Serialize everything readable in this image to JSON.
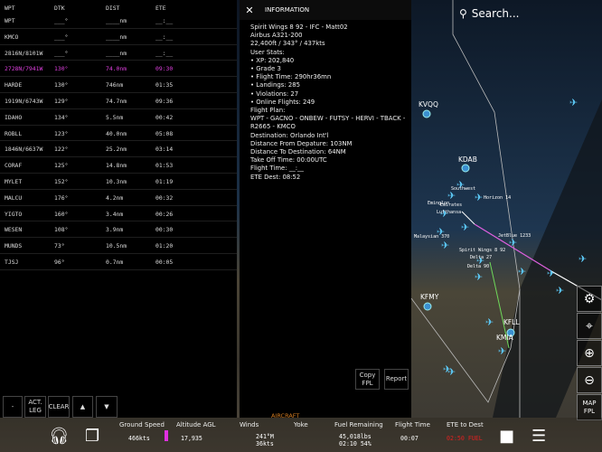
{
  "wpt_table": {
    "headers": [
      "WPT",
      "DTK",
      "DIST",
      "ETE"
    ],
    "rows": [
      [
        "WPT",
        "___°",
        "____nm",
        "__:__"
      ],
      [
        "KMCO",
        "___°",
        "____nm",
        "__:__"
      ],
      [
        "2816N/8101W",
        "___°",
        "____nm",
        "__:__"
      ],
      [
        "2728N/7941W",
        "130°",
        "74.0nm",
        "09:30"
      ],
      [
        "HARDE",
        "130°",
        "746nm",
        "01:35"
      ],
      [
        "1919N/6743W",
        "129°",
        "74.7nm",
        "09:36"
      ],
      [
        "IDAHO",
        "134°",
        "5.5nm",
        "00:42"
      ],
      [
        "ROBLL",
        "123°",
        "40.0nm",
        "05:08"
      ],
      [
        "1846N/6637W",
        "122°",
        "25.2nm",
        "03:14"
      ],
      [
        "CORAF",
        "125°",
        "14.8nm",
        "01:53"
      ],
      [
        "MYLET",
        "152°",
        "10.3nm",
        "01:19"
      ],
      [
        "MALCU",
        "176°",
        "4.2nm",
        "00:32"
      ],
      [
        "YIGTO",
        "160°",
        "3.4nm",
        "00:26"
      ],
      [
        "WESEN",
        "108°",
        "3.9nm",
        "00:30"
      ],
      [
        "MUNDS",
        "73°",
        "10.5nm",
        "01:20"
      ],
      [
        "TJSJ",
        "96°",
        "0.7nm",
        "00:05"
      ]
    ],
    "active_row": 3,
    "buttons": {
      "dash": "-",
      "act_leg": "ACT. LEG",
      "clear": "CLEAR",
      "up": "▲",
      "down": "▼"
    }
  },
  "info": {
    "title": "INFORMATION",
    "lines": [
      "Spirit Wings 8 92 - IFC - Matt02",
      "Airbus A321-200",
      "22,400ft / 343° / 437kts",
      "User Stats:",
      "• XP: 202,840",
      "•  Grade 3",
      "•  Flight Time: 290hr36mn",
      "•  Landings: 285",
      "• Violations: 27",
      "•  Online Flights: 249",
      "Flight Plan:",
      "WPT - GACNO - ONBEW - FUTSY - HERVI - TBACK -",
      "R2665 - KMCO",
      "Destination: Orlando Int'l",
      "Distance From Depature: 103NM",
      "Distance To Destination: 64NM",
      "Take Off Time: 00:00UTC",
      "Flight Time: __:__",
      "ETE Dest: 08:52"
    ],
    "copy_fpl": "Copy FPL",
    "report": "Report",
    "aircraft_tab": "AIRCRAFT"
  },
  "map": {
    "search_placeholder": "Search...",
    "airports": [
      "KVQQ",
      "KDAB",
      "KFMY",
      "KFLL",
      "KMIA"
    ],
    "callsigns": [
      "Southwest",
      "Emirates",
      "Lufthansa",
      "Eminglon",
      "Malaysian 370",
      "Spirit Wings 8 92",
      "Delta 27",
      "Delta 90",
      "JetBlue 1233",
      "Horizon 14"
    ],
    "map_fpl": "MAP FPL"
  },
  "bottom": {
    "ground_speed_label": "Ground Speed",
    "ground_speed": "466kts",
    "altitude_label": "Altitude AGL",
    "altitude": "17,935",
    "winds_label": "Winds",
    "winds_dir": "241°M",
    "winds_speed": "36kts",
    "yoke_label": "Yoke",
    "fuel_label": "Fuel Remaining",
    "fuel_lbs": "45,018lbs",
    "fuel_time": "02:10 54%",
    "flight_time_label": "Flight Time",
    "flight_time": "00:07",
    "ete_label": "ETE to Dest",
    "ete": "02:50 FUEL"
  },
  "colors": {
    "active": "#e040e0",
    "aircraft_tab": "#d07a20",
    "ete_fuel": "#e02020",
    "plane": "#5cc8f5"
  }
}
